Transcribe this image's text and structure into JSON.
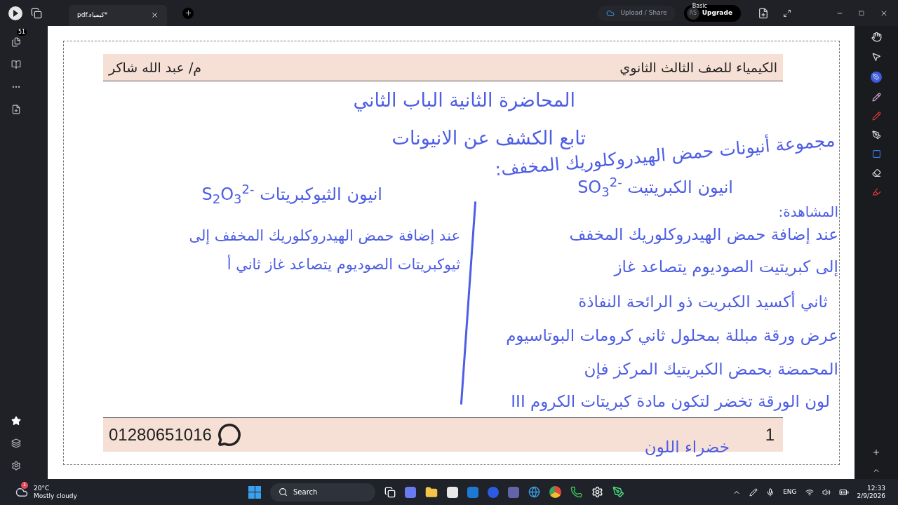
{
  "tab": {
    "title": "pdf.كيمياء*"
  },
  "top_bar": {
    "upload_label": "Upload / Share",
    "plan_badge": "Basic",
    "avatar_initials": "AS",
    "upgrade_label": "Upgrade"
  },
  "sidebar": {
    "pages_count": "51"
  },
  "page": {
    "header_right": "الكيمياء للصف الثالث الثانوي",
    "header_left": "م/ عبد الله شاكر",
    "footer_phone": "01280651016",
    "footer_page_number": "1"
  },
  "ink": {
    "title_lines": [
      "المحاضرة الثانية الباب الثاني",
      "تابع الكشف عن الانيونات"
    ],
    "group_heading": "مجموعة أنيونات حمض الهيدروكلوريك المخفف:",
    "right_column": {
      "heading": "SO$_{3}$$^{2-}$ انيون الكبريتيت",
      "subheading": "المشاهدة:",
      "lines": [
        "عند إضافة حمض الهيدروكلوريك المخفف",
        "إلى كبريتيت الصوديوم يتصاعد غاز",
        "ثاني أكسيد الكبريت ذو الرائحة النفاذة",
        "عرض ورقة مبللة بمحلول ثاني كرومات البوتاسيوم",
        "المحمضة بحمض الكبريتيك المركز فإن",
        "لون الورقة تخضر لتكون مادة كبريتات الكروم III",
        "خضراء اللون"
      ]
    },
    "left_column": {
      "heading": "S$_{2}$O$_{3}$$^{2-}$ انيون الثيوكبريتات",
      "lines": [
        "عند إضافة حمض الهيدروكلوريك المخفف إلى",
        "ثيوكبريتات الصوديوم يتصاعد غاز ثاني أ"
      ]
    }
  },
  "taskbar": {
    "temperature": "20°C",
    "weather": "Mostly cloudy",
    "weather_alerts": "1",
    "search_label": "Search",
    "language": "ENG",
    "time": "12:33",
    "date": "2/9/2026"
  }
}
